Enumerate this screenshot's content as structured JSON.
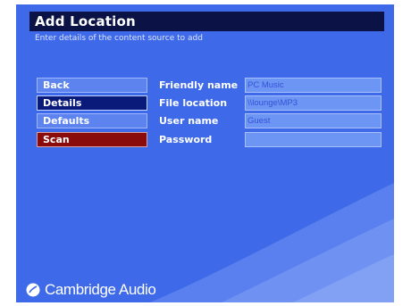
{
  "header": {
    "title": "Add Location",
    "subtitle": "Enter details of the content source to add"
  },
  "menu": {
    "items": [
      {
        "label": "Back",
        "state": "normal"
      },
      {
        "label": "Details",
        "state": "selected"
      },
      {
        "label": "Defaults",
        "state": "normal"
      },
      {
        "label": "Scan",
        "state": "highlight"
      }
    ]
  },
  "form": {
    "fields": [
      {
        "label": "Friendly name",
        "value": "PC Music"
      },
      {
        "label": "File location",
        "value": "\\\\lounge\\MP3"
      },
      {
        "label": "User name",
        "value": "Guest"
      },
      {
        "label": "Password",
        "value": ""
      }
    ]
  },
  "brand": {
    "name": "Cambridge Audio"
  },
  "colors": {
    "background": "#3e69e8",
    "titlebar": "#0b1346",
    "selected": "#0a1a7a",
    "scan": "#8a0b0b",
    "button": "#5d83ee"
  }
}
